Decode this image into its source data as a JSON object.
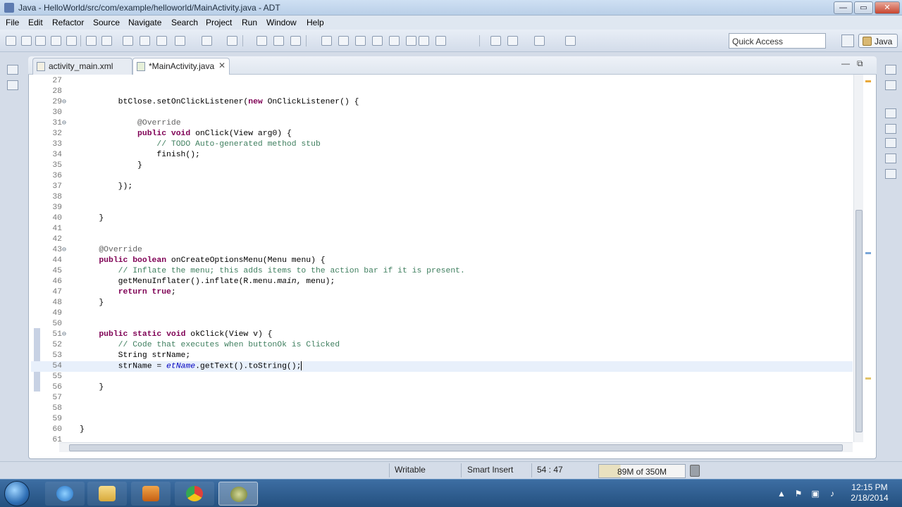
{
  "window": {
    "title": "Java - HelloWorld/src/com/example/helloworld/MainActivity.java - ADT",
    "minimize_label": "—",
    "maximize_label": "▭",
    "close_label": "✕"
  },
  "menu": [
    "File",
    "Edit",
    "Refactor",
    "Source",
    "Navigate",
    "Search",
    "Project",
    "Run",
    "Window",
    "Help"
  ],
  "toolbar": {
    "quick_access_placeholder": "Quick Access",
    "perspective_label": "Java"
  },
  "tabs": [
    {
      "label": "activity_main.xml",
      "active": false
    },
    {
      "label": "*MainActivity.java",
      "active": true,
      "close": "✕"
    }
  ],
  "tabbar_controls": {
    "minimize": "—",
    "maximize": "⧉"
  },
  "editor": {
    "lines": [
      {
        "n": "27",
        "fold": "",
        "code": ""
      },
      {
        "n": "28",
        "fold": "",
        "code": ""
      },
      {
        "n": "29",
        "fold": "⊖",
        "code": "        btClose.setOnClickListener(new OnClickListener() {"
      },
      {
        "n": "30",
        "fold": "",
        "code": ""
      },
      {
        "n": "31",
        "fold": "⊖",
        "code": "            @Override"
      },
      {
        "n": "32",
        "fold": "",
        "code": "            public void onClick(View arg0) {"
      },
      {
        "n": "33",
        "fold": "",
        "code": "                // TODO Auto-generated method stub"
      },
      {
        "n": "34",
        "fold": "",
        "code": "                finish();"
      },
      {
        "n": "35",
        "fold": "",
        "code": "            }"
      },
      {
        "n": "36",
        "fold": "",
        "code": ""
      },
      {
        "n": "37",
        "fold": "",
        "code": "        });"
      },
      {
        "n": "38",
        "fold": "",
        "code": ""
      },
      {
        "n": "39",
        "fold": "",
        "code": ""
      },
      {
        "n": "40",
        "fold": "",
        "code": "    }"
      },
      {
        "n": "41",
        "fold": "",
        "code": ""
      },
      {
        "n": "42",
        "fold": "",
        "code": ""
      },
      {
        "n": "43",
        "fold": "⊖",
        "code": "    @Override"
      },
      {
        "n": "44",
        "fold": "",
        "code": "    public boolean onCreateOptionsMenu(Menu menu) {"
      },
      {
        "n": "45",
        "fold": "",
        "code": "        // Inflate the menu; this adds items to the action bar if it is present."
      },
      {
        "n": "46",
        "fold": "",
        "code": "        getMenuInflater().inflate(R.menu.main, menu);"
      },
      {
        "n": "47",
        "fold": "",
        "code": "        return true;"
      },
      {
        "n": "48",
        "fold": "",
        "code": "    }"
      },
      {
        "n": "49",
        "fold": "",
        "code": ""
      },
      {
        "n": "50",
        "fold": "",
        "code": ""
      },
      {
        "n": "51",
        "fold": "⊖",
        "code": "    public static void okClick(View v) {"
      },
      {
        "n": "52",
        "fold": "",
        "code": "        // Code that executes when buttonOk is Clicked"
      },
      {
        "n": "53",
        "fold": "",
        "code": "        String strName;"
      },
      {
        "n": "54",
        "fold": "",
        "code": "        strName = etName.getText().toString();"
      },
      {
        "n": "55",
        "fold": "",
        "code": ""
      },
      {
        "n": "56",
        "fold": "",
        "code": "    }"
      },
      {
        "n": "57",
        "fold": "",
        "code": ""
      },
      {
        "n": "58",
        "fold": "",
        "code": ""
      },
      {
        "n": "59",
        "fold": "",
        "code": ""
      },
      {
        "n": "60",
        "fold": "",
        "code": "}"
      },
      {
        "n": "61",
        "fold": "",
        "code": ""
      }
    ],
    "current_line": "54"
  },
  "status": {
    "writable": "Writable",
    "insert_mode": "Smart Insert",
    "position": "54 : 47",
    "heap": "89M of 350M",
    "heap_used_fraction": 0.25
  },
  "taskbar": {
    "time": "12:15 PM",
    "date": "2/18/2014"
  },
  "colors": {
    "keyword": "#7f0055",
    "comment": "#3f7f5f",
    "annotation": "#646464",
    "field": "#0000c0",
    "current_line": "#e8f0fb"
  }
}
